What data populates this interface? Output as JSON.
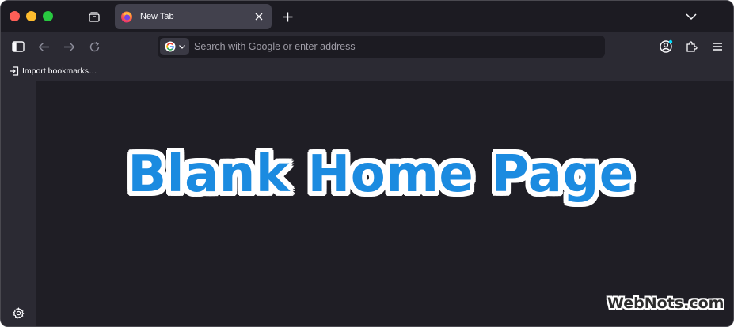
{
  "window": {
    "controls": [
      "close",
      "minimize",
      "zoom"
    ],
    "colors": {
      "close": "#fe5f57",
      "minimize": "#febc2e",
      "zoom": "#28c840"
    }
  },
  "tabstrip": {
    "overview_icon": "tab-overview-icon",
    "tabs": [
      {
        "title": "New Tab",
        "icon": "firefox-icon",
        "active": true
      }
    ],
    "new_tab_icon": "plus-icon",
    "list_all_icon": "chevron-down-icon"
  },
  "toolbar": {
    "sidebar_icon": "sidebar-icon",
    "back_icon": "back-arrow-icon",
    "forward_icon": "forward-arrow-icon",
    "reload_icon": "reload-icon",
    "search_engine_icon": "google-icon",
    "url_placeholder": "Search with Google or enter address",
    "url_value": "",
    "account_icon": "account-icon",
    "extensions_icon": "puzzle-icon",
    "menu_icon": "hamburger-menu-icon"
  },
  "bookmarks": {
    "import_label": "Import bookmarks…",
    "import_icon": "import-icon"
  },
  "sidebar": {
    "settings_icon": "gear-icon"
  },
  "overlay": {
    "title": "Blank Home Page",
    "title_color": "#1b8be0",
    "watermark": "WebNots.com"
  }
}
